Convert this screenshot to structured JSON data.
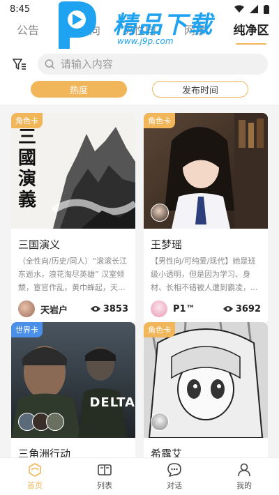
{
  "status_bar": {
    "time": "8:45"
  },
  "tabs": [
    {
      "label": "公告"
    },
    {
      "label": "女性向"
    },
    {
      "label": "男性向"
    },
    {
      "label": "网事"
    },
    {
      "label": "纯净区"
    }
  ],
  "watermark": {
    "title": "精品下载",
    "url": "www.j9p.com"
  },
  "search": {
    "placeholder": "请输入内容"
  },
  "sort": {
    "hot_label": "热度",
    "time_label": "发布时间"
  },
  "cards": [
    {
      "badge": "角色卡",
      "title": "三国演义",
      "desc": "（全性向/历史/同人）“滚滚长江东逝水，浪花淘尽英雄” 汉室倾颓，宦官作乱，黄巾蜂起，天...",
      "author": "天岩户",
      "views": "3853",
      "cover_text": "三國演義"
    },
    {
      "badge": "角色卡",
      "title": "王梦瑶",
      "desc": "【男性向/可纯爱/现代】她是班级小透明，但是因为学习、身材、长相不错被人遭到霸凌，...",
      "author": "P1™",
      "views": "3692"
    },
    {
      "badge": "世界卡",
      "title": "三角洲行动",
      "cover_text": "DELTA"
    },
    {
      "badge": "角色卡",
      "title": "希露艾"
    }
  ],
  "nav": [
    {
      "label": "首页"
    },
    {
      "label": "列表"
    },
    {
      "label": "对话"
    },
    {
      "label": "我的"
    }
  ],
  "colors": {
    "accent": "#f2b65a",
    "world_badge": "#4a8fe8",
    "watermark": "#1fa3f0"
  }
}
